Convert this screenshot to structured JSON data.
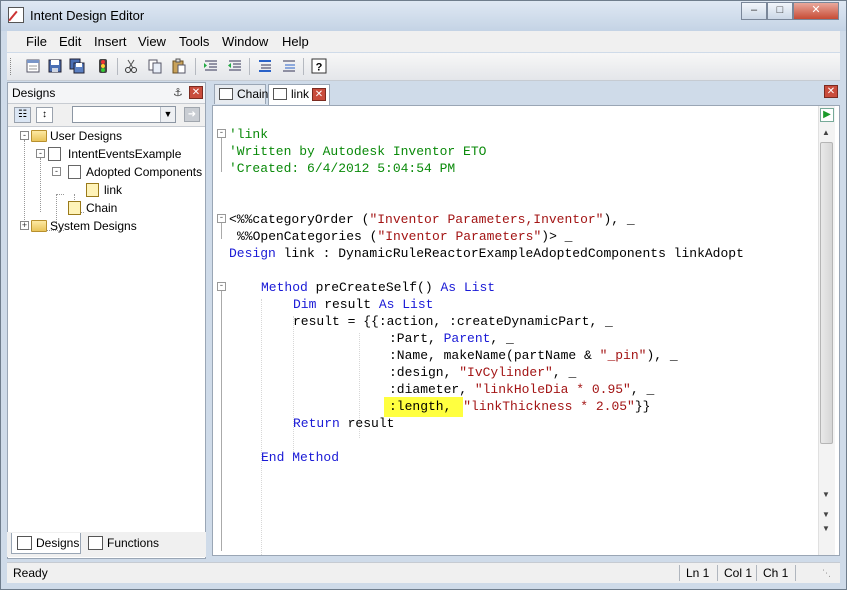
{
  "window": {
    "title": "Intent Design Editor"
  },
  "menu": [
    "File",
    "Edit",
    "Insert",
    "View",
    "Tools",
    "Window",
    "Help"
  ],
  "toolbar": {
    "icons": [
      "new-icon",
      "save-icon",
      "save-all-icon",
      "traffic-light-icon",
      "cut-icon",
      "copy-icon",
      "paste-icon",
      "indent-icon",
      "outdent-icon",
      "comment-icon",
      "uncomment-icon",
      "help-icon"
    ]
  },
  "designs_panel": {
    "title": "Designs",
    "search_value": "",
    "tree": {
      "user_designs": "User Designs",
      "intent_events": "IntentEventsExample",
      "adopted": "Adopted Components",
      "link": "link",
      "chain": "Chain",
      "system_designs": "System Designs"
    },
    "bottom_tabs": [
      "Designs",
      "Functions"
    ]
  },
  "doc_tabs": [
    "Chain",
    "link"
  ],
  "code": {
    "l1": "'link",
    "l2": "'Written by Autodesk Inventor ETO",
    "l3": "'Created: 6/4/2012 5:04:54 PM",
    "l4a": "<%%categoryOrder (",
    "l4b": "\"Inventor Parameters,Inventor\"",
    "l4c": "), _",
    "l5a": "%%OpenCategories (",
    "l5b": "\"Inventor Parameters\"",
    "l5c": ")> _",
    "l6a": "Design",
    "l6b": " link : DynamicRuleReactorExampleAdoptedComponents linkAdopt",
    "l7a": "Method",
    "l7b": " preCreateSelf() ",
    "l7c": "As List",
    "l8a": "Dim",
    "l8b": " result ",
    "l8c": "As List",
    "l9": "result = {{:action, :createDynamicPart, _",
    "l10a": ":Part, ",
    "l10b": "Parent",
    "l10c": ", _",
    "l11a": ":Name, makeName(partName & ",
    "l11b": "\"_pin\"",
    "l11c": "), _",
    "l12a": ":design, ",
    "l12b": "\"IvCylinder\"",
    "l12c": ", _",
    "l13a": ":diameter, ",
    "l13b": "\"linkHoleDia * 0.95\"",
    "l13c": ", _",
    "l14a": ":length, ",
    "l14b": "\"linkThickness * 2.05\"",
    "l14c": "}}",
    "l15a": "Return",
    "l15b": " result",
    "l16": "End Method"
  },
  "status": {
    "text": "Ready",
    "ln": "Ln 1",
    "col": "Col 1",
    "ch": "Ch 1"
  }
}
